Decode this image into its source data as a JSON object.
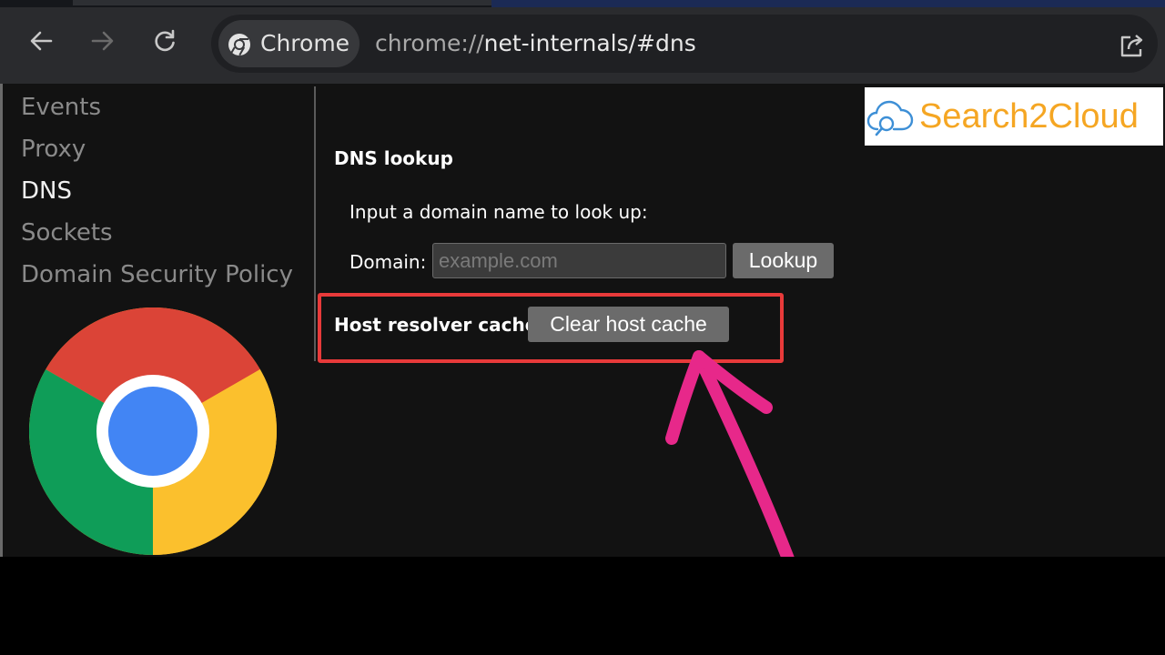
{
  "browser": {
    "back_icon": "arrow-left-icon",
    "forward_icon": "arrow-right-icon",
    "reload_icon": "reload-icon",
    "chip_label": "Chrome",
    "url_scheme": "chrome://",
    "url_rest": "net-internals/#dns",
    "share_icon": "share-icon"
  },
  "sidebar": {
    "items": [
      {
        "label": "Events",
        "active": false
      },
      {
        "label": "Proxy",
        "active": false
      },
      {
        "label": "DNS",
        "active": true
      },
      {
        "label": "Sockets",
        "active": false
      },
      {
        "label": "Domain Security Policy",
        "active": false
      }
    ]
  },
  "dns": {
    "lookup_heading": "DNS lookup",
    "prompt": "Input a domain name to look up:",
    "domain_label": "Domain:",
    "domain_placeholder": "example.com",
    "domain_value": "",
    "lookup_button": "Lookup",
    "host_cache_heading": "Host resolver cache",
    "clear_button": "Clear host cache"
  },
  "overlay": {
    "logo_text": "Search2Cloud",
    "logo_color": "#f5a623",
    "highlight_color": "#e83a3a",
    "arrow_color": "#e7288a"
  },
  "colors": {
    "page_bg": "#121212",
    "toolbar_bg": "#2a2b2e",
    "button_bg": "#6b6b6b"
  }
}
